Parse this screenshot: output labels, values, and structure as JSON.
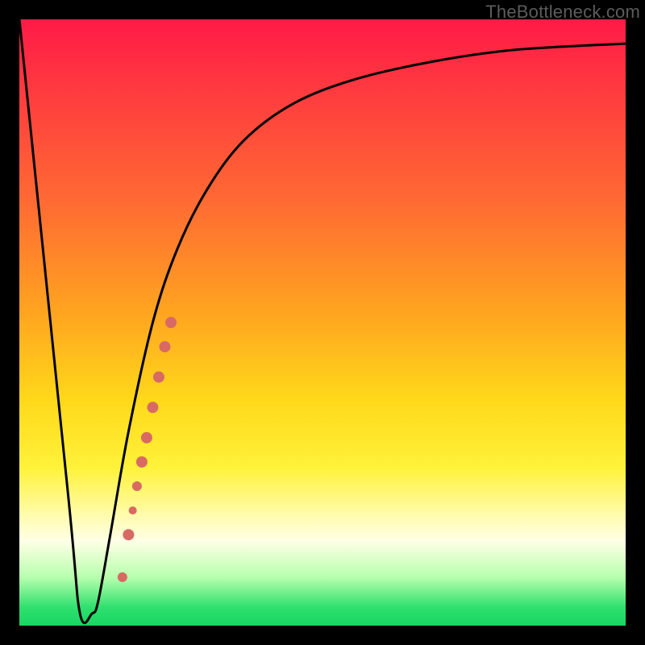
{
  "watermark": "TheBottleneck.com",
  "chart_data": {
    "type": "line",
    "title": "",
    "xlabel": "",
    "ylabel": "",
    "xlim": [
      0,
      100
    ],
    "ylim": [
      0,
      100
    ],
    "grid": false,
    "legend": false,
    "series": [
      {
        "name": "bottleneck-curve",
        "x": [
          0,
          8,
          10,
          12,
          13,
          15,
          18,
          22,
          26,
          31,
          37,
          45,
          55,
          68,
          82,
          100
        ],
        "y": [
          100,
          22,
          2,
          2,
          4,
          15,
          32,
          50,
          62,
          72,
          80,
          86,
          90,
          93,
          95,
          96
        ]
      }
    ],
    "highlight_points": [
      {
        "x": 17.0,
        "y": 8,
        "r": 6
      },
      {
        "x": 18.0,
        "y": 15,
        "r": 7
      },
      {
        "x": 18.7,
        "y": 19,
        "r": 5
      },
      {
        "x": 19.4,
        "y": 23,
        "r": 6
      },
      {
        "x": 20.2,
        "y": 27,
        "r": 7
      },
      {
        "x": 21.0,
        "y": 31,
        "r": 7
      },
      {
        "x": 22.0,
        "y": 36,
        "r": 7
      },
      {
        "x": 23.0,
        "y": 41,
        "r": 7
      },
      {
        "x": 24.0,
        "y": 46,
        "r": 7
      },
      {
        "x": 25.0,
        "y": 50,
        "r": 7
      }
    ],
    "highlight_color": "#d86a63",
    "curve_color": "#000000",
    "curve_width": 3
  }
}
